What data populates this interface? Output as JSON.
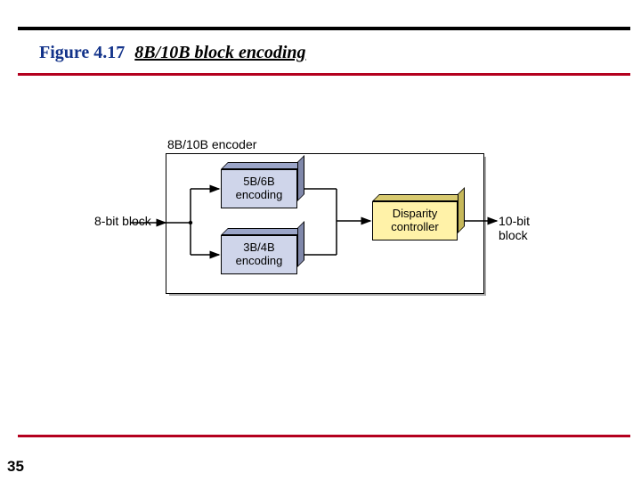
{
  "figure": {
    "number": "Figure 4.17",
    "caption": "8B/10B block encoding"
  },
  "diagram": {
    "encoder_label": "8B/10B encoder",
    "input_label": "8-bit block",
    "output_label": "10-bit block",
    "block_5b6b_l1": "5B/6B",
    "block_5b6b_l2": "encoding",
    "block_3b4b_l1": "3B/4B",
    "block_3b4b_l2": "encoding",
    "disparity_l1": "Disparity",
    "disparity_l2": "controller"
  },
  "page": {
    "number": "35"
  }
}
